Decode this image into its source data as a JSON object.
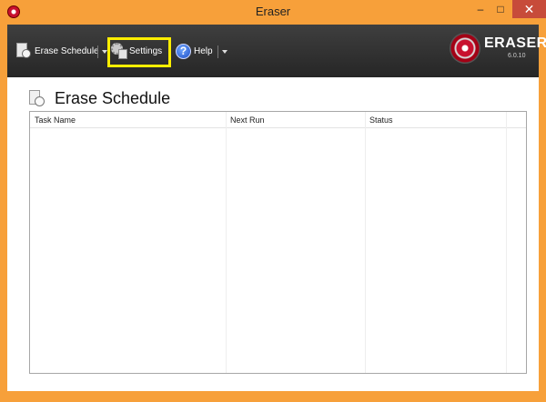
{
  "window": {
    "title": "Eraser",
    "controls": {
      "minimize": "–",
      "maximize": "□",
      "close": "✕"
    }
  },
  "toolbar": {
    "erase_schedule_label": "Erase Schedule",
    "settings_label": "Settings",
    "help_label": "Help",
    "help_glyph": "?"
  },
  "brand": {
    "name": "ERASER",
    "version": "6.0.10"
  },
  "page": {
    "title": "Erase Schedule"
  },
  "table": {
    "columns": [
      "Task Name",
      "Next Run",
      "Status"
    ],
    "rows": []
  },
  "colors": {
    "frame": "#f7a03a",
    "toolbar": "#2e2e2e",
    "highlight": "#ffee00",
    "close_button": "#c74b3a"
  },
  "icons": [
    "eraser-app-icon",
    "schedule-clock-icon",
    "settings-gear-icon",
    "help-icon",
    "eraser-logo-icon"
  ]
}
